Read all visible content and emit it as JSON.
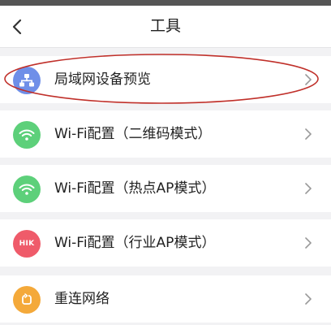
{
  "header": {
    "title": "工具"
  },
  "items": [
    {
      "label": "局域网设备预览",
      "icon": "lan-device-icon",
      "color": "#6f8fe8"
    },
    {
      "label": "Wi-Fi配置（二维码模式）",
      "icon": "wifi-icon",
      "color": "#5dd07a"
    },
    {
      "label": "Wi-Fi配置（热点AP模式）",
      "icon": "wifi-icon",
      "color": "#5dd07a"
    },
    {
      "label": "Wi-Fi配置（行业AP模式）",
      "icon": "hik-icon",
      "icon_text": "HIK",
      "color": "#ef5b6a"
    },
    {
      "label": "重连网络",
      "icon": "reconnect-icon",
      "color": "#f4a93a"
    }
  ],
  "annotation": {
    "color": "#c0302a"
  }
}
